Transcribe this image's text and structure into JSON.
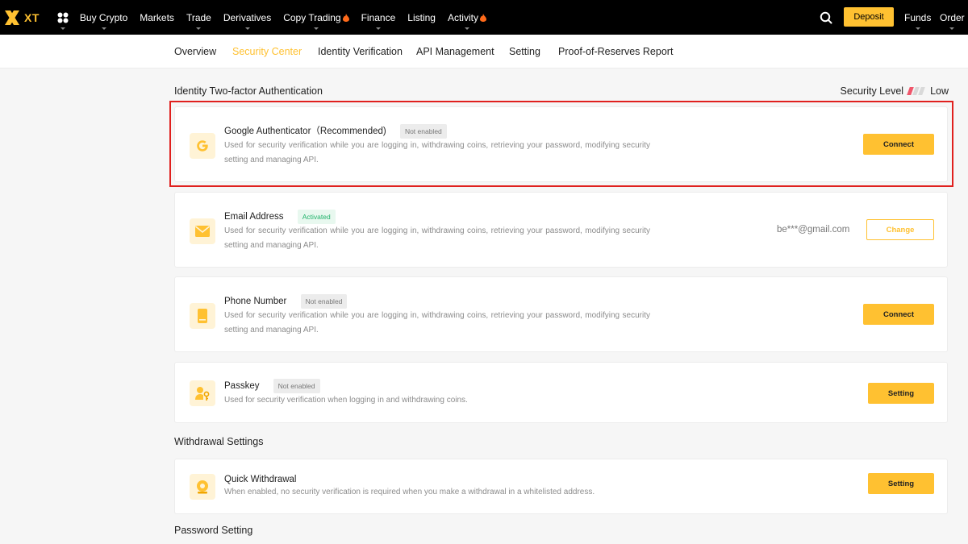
{
  "brand": {
    "name": "XT",
    "accent": "#ffc131"
  },
  "topnav": {
    "items": [
      {
        "label": "Buy Crypto",
        "caret": true,
        "flame": false
      },
      {
        "label": "Markets",
        "caret": false,
        "flame": false
      },
      {
        "label": "Trade",
        "caret": true,
        "flame": false
      },
      {
        "label": "Derivatives",
        "caret": true,
        "flame": false
      },
      {
        "label": "Copy Trading",
        "caret": true,
        "flame": true
      },
      {
        "label": "Finance",
        "caret": true,
        "flame": false
      },
      {
        "label": "Listing",
        "caret": false,
        "flame": false
      },
      {
        "label": "Activity",
        "caret": true,
        "flame": true
      }
    ],
    "deposit_label": "Deposit",
    "funds_label": "Funds",
    "order_label": "Order"
  },
  "subnav": {
    "tabs": [
      {
        "label": "Overview"
      },
      {
        "label": "Security Center"
      },
      {
        "label": "Identity Verification"
      },
      {
        "label": "API Management"
      },
      {
        "label": "Setting"
      },
      {
        "label": "Proof-of-Reserves Report"
      }
    ],
    "active_index": 1
  },
  "sections": {
    "two_factor": "Identity Two-factor Authentication",
    "withdrawal": "Withdrawal Settings",
    "password": "Password Setting"
  },
  "security_level": {
    "label": "Security Level",
    "value": "Low",
    "bars_filled": 1,
    "bars_total": 3,
    "filled_color": "#f0566b",
    "empty_color": "#d9d9d9"
  },
  "cards": {
    "google": {
      "icon": "google-icon",
      "title": "Google Authenticator（Recommended)",
      "badge": "Not enabled",
      "desc": "Used for security verification while you are logging in, withdrawing coins, retrieving your password, modifying security setting and managing API.",
      "button": "Connect"
    },
    "email": {
      "icon": "envelope-icon",
      "title": "Email Address",
      "badge": "Activated",
      "desc": "Used for security verification while you are logging in, withdrawing coins, retrieving your password, modifying security setting and managing API.",
      "value": "be***@gmail.com",
      "button": "Change"
    },
    "phone": {
      "icon": "phone-icon",
      "title": "Phone Number",
      "badge": "Not enabled",
      "desc": "Used for security verification while you are logging in, withdrawing coins, retrieving your password, modifying security setting and managing API.",
      "button": "Connect"
    },
    "passkey": {
      "icon": "passkey-icon",
      "title": "Passkey",
      "badge": "Not enabled",
      "desc": "Used for security verification when logging in and withdrawing coins.",
      "button": "Setting"
    },
    "quick_withdrawal": {
      "icon": "quick-withdrawal-icon",
      "title": "Quick Withdrawal",
      "desc": "When enabled, no security verification is required when you make a withdrawal in a whitelisted address.",
      "button": "Setting"
    }
  }
}
